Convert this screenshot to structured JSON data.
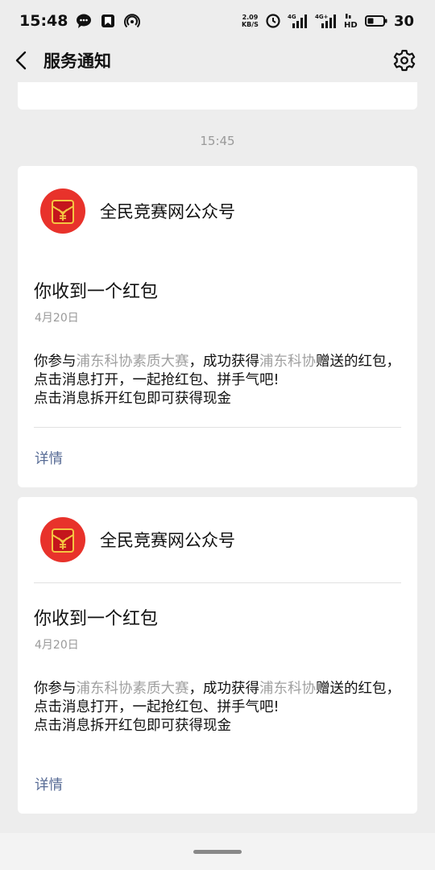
{
  "status_bar": {
    "time": "15:48",
    "net_speed_value": "2.09",
    "net_speed_unit": "KB/S",
    "signal_1_label": "4G",
    "signal_2_label": "4G+",
    "battery_percent": "30"
  },
  "nav": {
    "title": "服务通知"
  },
  "timestamp": "15:45",
  "cards": [
    {
      "account_name": "全民竞赛网公众号",
      "title": "你收到一个红包",
      "date": "4月20日",
      "body": {
        "part1": "你参与",
        "highlight1": "浦东科协素质大赛",
        "part2": "，成功获得",
        "highlight2": "浦东科协",
        "part3": "赠送的红包，点击消息打开，一起抢红包、拼手气吧!",
        "line2": "点击消息拆开红包即可获得现金"
      },
      "detail_label": "详情"
    },
    {
      "account_name": "全民竞赛网公众号",
      "title": "你收到一个红包",
      "date": "4月20日",
      "body": {
        "part1": "你参与",
        "highlight1": "浦东科协素质大赛",
        "part2": "，成功获得",
        "highlight2": "浦东科协",
        "part3": "赠送的红包，点击消息打开，一起抢红包、拼手气吧!",
        "line2": "点击消息拆开红包即可获得现金"
      },
      "detail_label": "详情"
    }
  ],
  "colors": {
    "link": "#576b95",
    "highlight": "#a0a0a0",
    "red_packet": "#e8322b",
    "packet_gold": "#f5c542"
  },
  "icons": {
    "back": "chevron-left-icon",
    "settings": "gear-icon",
    "avatar": "red-packet-icon"
  }
}
